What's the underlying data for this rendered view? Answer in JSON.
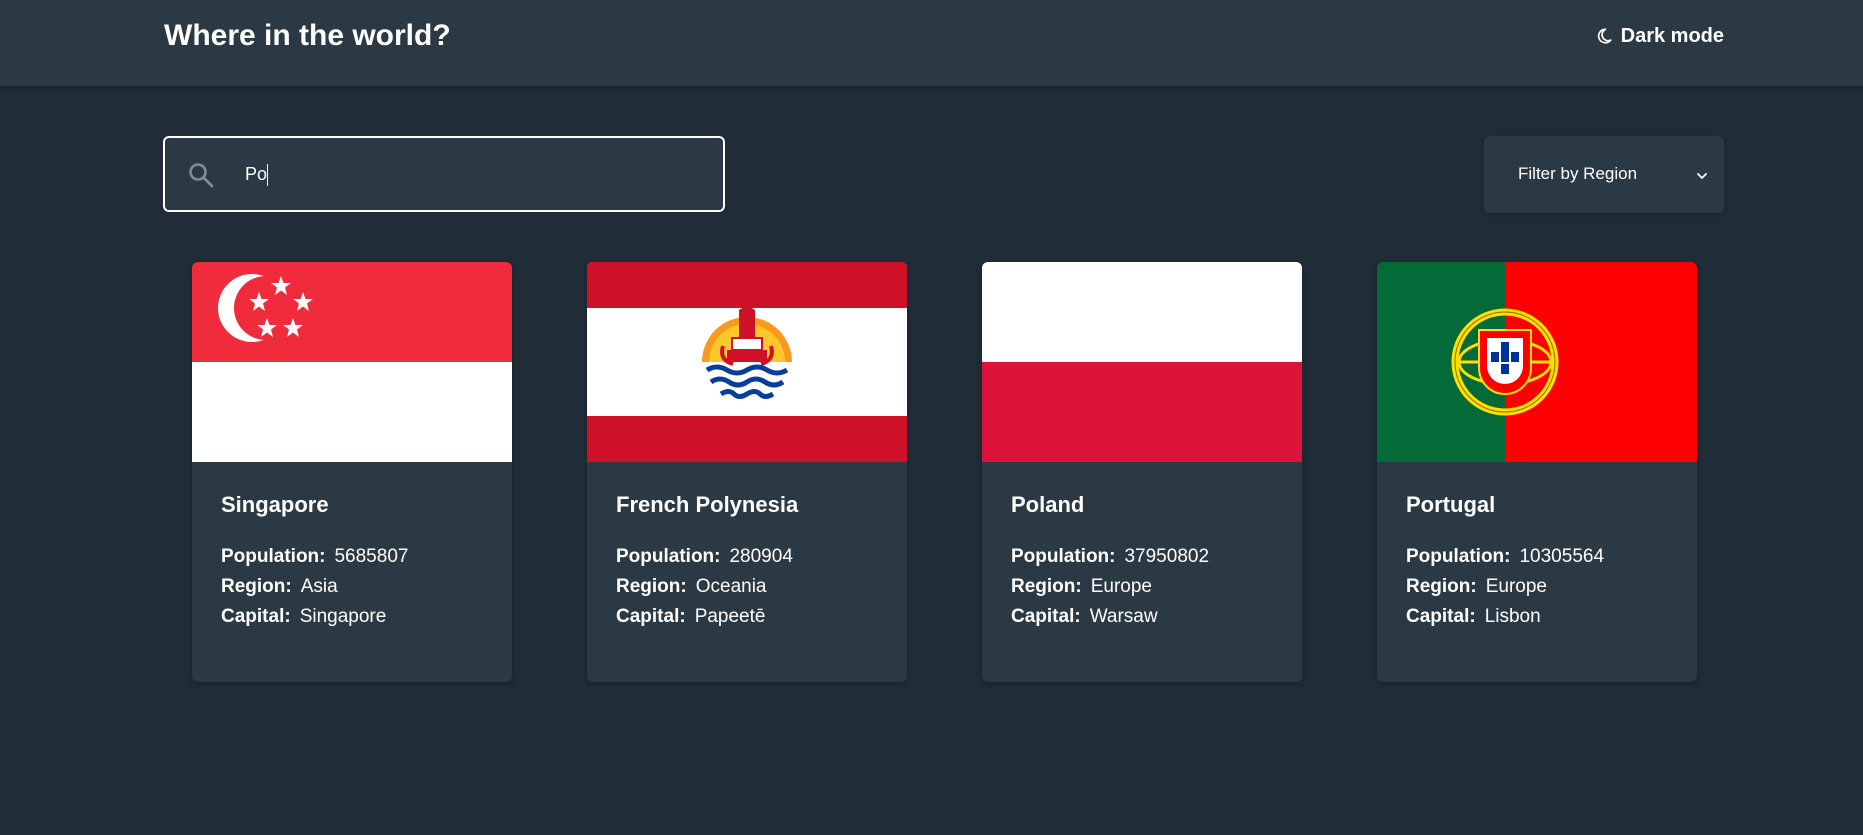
{
  "header": {
    "title": "Where in the world?",
    "theme_toggle_label": "Dark mode",
    "theme_icon": "moon-icon"
  },
  "search": {
    "value": "Po",
    "icon": "search-icon"
  },
  "filter": {
    "label": "Filter by Region",
    "icon": "chevron-down-icon"
  },
  "labels": {
    "population": "Population:",
    "region": "Region:",
    "capital": "Capital:"
  },
  "countries": [
    {
      "name": "Singapore",
      "population": "5685807",
      "region": "Asia",
      "capital": "Singapore",
      "flag": "singapore-flag"
    },
    {
      "name": "French Polynesia",
      "population": "280904",
      "region": "Oceania",
      "capital": "Papeetē",
      "flag": "french-polynesia-flag"
    },
    {
      "name": "Poland",
      "population": "37950802",
      "region": "Europe",
      "capital": "Warsaw",
      "flag": "poland-flag"
    },
    {
      "name": "Portugal",
      "population": "10305564",
      "region": "Europe",
      "capital": "Lisbon",
      "flag": "portugal-flag"
    }
  ],
  "colors": {
    "background": "#202c37",
    "elements": "#2b3945",
    "text": "#ffffff"
  }
}
